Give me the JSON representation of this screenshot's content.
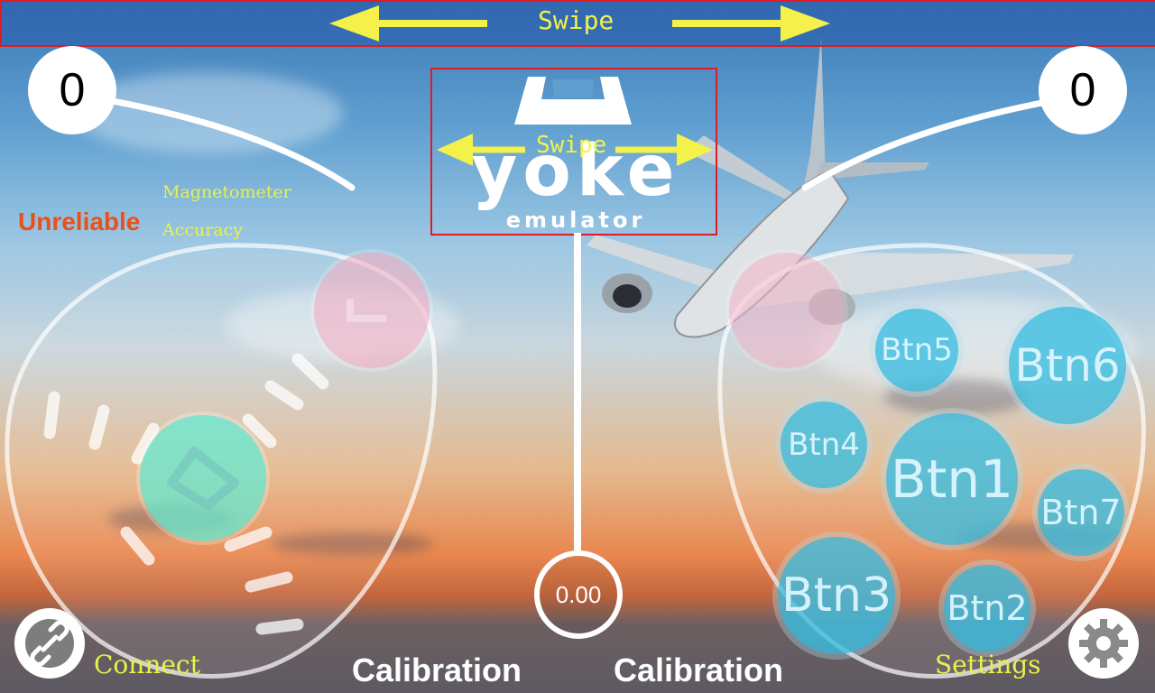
{
  "swipe": {
    "top_label": "Swipe",
    "logo_label": "Swipe"
  },
  "logo": {
    "line1": "yoke",
    "line2": "emulator"
  },
  "counters": {
    "left": "0",
    "right": "0"
  },
  "sensor": {
    "status": "Unreliable",
    "label_line1": "Magnetometer",
    "label_line2": "Accuracy"
  },
  "center_gauge": {
    "value": "0.00"
  },
  "buttons": [
    "Btn1",
    "Btn2",
    "Btn3",
    "Btn4",
    "Btn5",
    "Btn6",
    "Btn7"
  ],
  "bottom": {
    "connect_label": "Connect",
    "settings_label": "Settings",
    "calibration_left": "Calibration",
    "calibration_right": "Calibration"
  },
  "icons": {
    "connect": "unlink-icon",
    "settings": "gear-icon",
    "swipe": "double-arrow-icon"
  },
  "colors": {
    "accent_yellow": "#f3f14a",
    "warning": "#e8501c",
    "button_blue": "#3cbee1",
    "outline_red": "#e01b24"
  }
}
